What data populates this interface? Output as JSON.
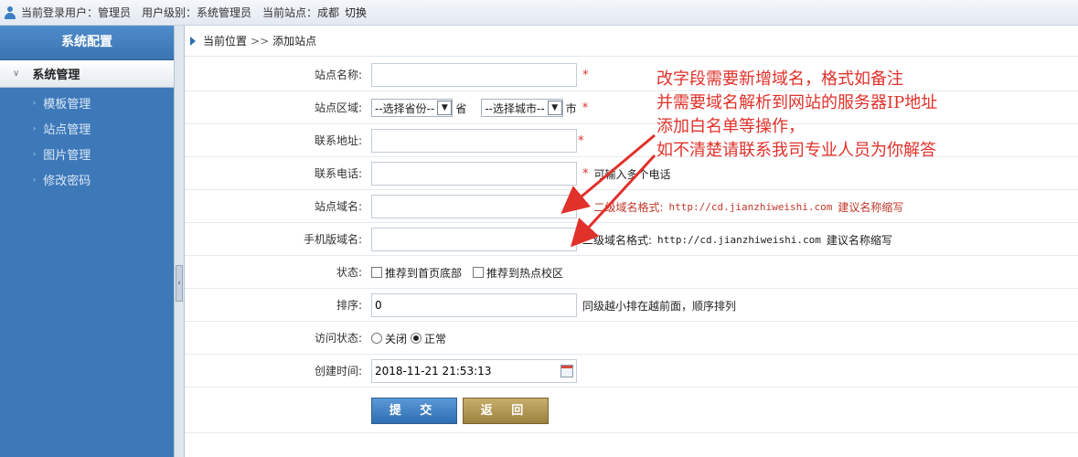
{
  "topbar": {
    "login_user": "当前登录用户：管理员",
    "user_level": "用户级别：系统管理员",
    "current_site": "当前站点：成都",
    "switch_label": "切换"
  },
  "sidebar": {
    "title": "系统配置",
    "group": "系统管理",
    "items": [
      {
        "label": "模板管理"
      },
      {
        "label": "站点管理"
      },
      {
        "label": "图片管理"
      },
      {
        "label": "修改密码"
      }
    ]
  },
  "breadcrumb": {
    "current_label": "当前位置",
    "separator": ">>",
    "page": "添加站点"
  },
  "form": {
    "site_name": {
      "label": "站点名称:",
      "value": "",
      "required": "*"
    },
    "site_region": {
      "label": "站点区域:",
      "province": "--选择省份--",
      "province_unit": "省",
      "city": "--选择城市--",
      "city_unit": "市",
      "required": "*"
    },
    "address": {
      "label": "联系地址:",
      "value": "",
      "required": "*"
    },
    "phone": {
      "label": "联系电话:",
      "value": "",
      "required": "*",
      "note": "可输入多个电话"
    },
    "site_domain": {
      "label": "站点域名:",
      "value": "",
      "required": "*",
      "note_prefix": "二级域名格式:",
      "note_url": "http://cd.jianzhiweishi.com",
      "note_suffix": "建议名称缩写"
    },
    "mobile_domain": {
      "label": "手机版域名:",
      "value": "",
      "note_prefix": "二级域名格式:",
      "note_url": "http://cd.jianzhiweishi.com",
      "note_suffix": "建议名称缩写"
    },
    "status": {
      "label": "状态:",
      "option1": "推荐到首页底部",
      "option2": "推荐到热点校区"
    },
    "sort": {
      "label": "排序:",
      "value": "0",
      "note": "同级越小排在越前面，顺序排列"
    },
    "access": {
      "label": "访问状态:",
      "closed": "关闭",
      "normal": "正常",
      "selected": "正常"
    },
    "created": {
      "label": "创建时间:",
      "value": "2018-11-21 21:53:13"
    }
  },
  "buttons": {
    "submit": "提 交",
    "back": "返 回"
  },
  "annotation": {
    "lines": [
      "改字段需要新增域名，格式如备注",
      "并需要域名解析到网站的服务器IP地址",
      "添加白名单等操作，",
      "如不清楚请联系我司专业人员为你解答"
    ],
    "color": "#e0312a"
  },
  "colors": {
    "sidebar": "#3d79b9",
    "submit": "#2e6fb2",
    "back": "#9c8240",
    "required": "#e0312a"
  }
}
